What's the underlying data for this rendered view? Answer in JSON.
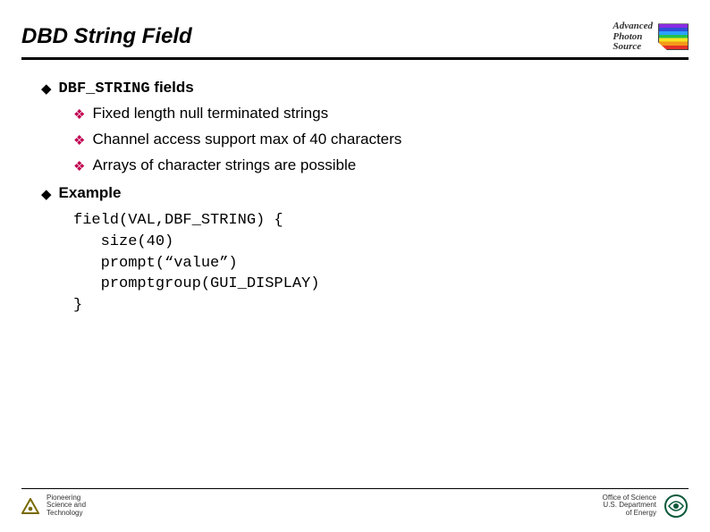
{
  "title": "DBD String Field",
  "logo_aps": {
    "line1": "Advanced",
    "line2": "Photon",
    "line3": "Source"
  },
  "bullets": {
    "h1a_prefix": "DBF_STRING",
    "h1a_suffix": " fields",
    "s1": "Fixed length null terminated strings",
    "s2": "Channel access support max of 40 characters",
    "s3": "Arrays of character strings are possible",
    "h1b": "Example"
  },
  "code": "field(VAL,DBF_STRING) {\n   size(40)\n   prompt(“value”)\n   promptgroup(GUI_DISPLAY)\n}",
  "footer": {
    "left1": "Pioneering",
    "left2": "Science and",
    "left3": "Technology",
    "right1": "Office of Science",
    "right2": "U.S. Department",
    "right3": "of Energy"
  }
}
